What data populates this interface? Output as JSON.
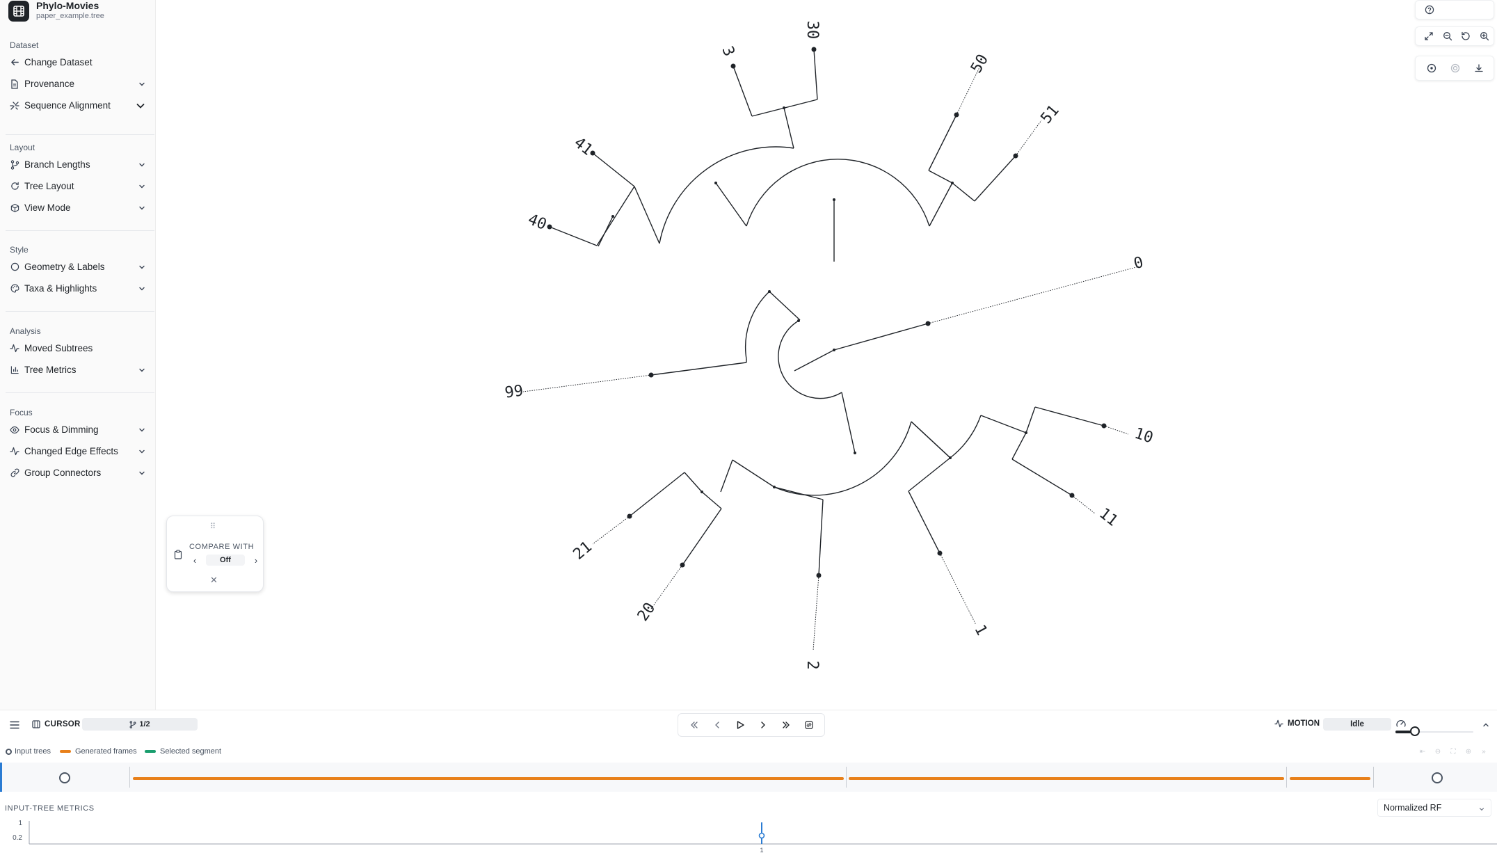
{
  "app": {
    "title": "Phylo-Movies",
    "file": "paper_example.tree"
  },
  "sidebar": {
    "sections": [
      {
        "title": "Dataset",
        "items": [
          {
            "label": "Change Dataset",
            "icon": "arrow-left-icon"
          },
          {
            "label": "Provenance",
            "icon": "document-icon"
          },
          {
            "label": "Sequence Alignment",
            "icon": "alignment-icon"
          }
        ]
      },
      {
        "title": "Layout",
        "items": [
          {
            "label": "Branch Lengths",
            "icon": "branch-icon"
          },
          {
            "label": "Tree Layout",
            "icon": "refresh-icon"
          },
          {
            "label": "View Mode",
            "icon": "cube-icon"
          }
        ]
      },
      {
        "title": "Style",
        "items": [
          {
            "label": "Geometry & Labels",
            "icon": "circle-icon"
          },
          {
            "label": "Taxa & Highlights",
            "icon": "palette-icon"
          }
        ]
      },
      {
        "title": "Analysis",
        "items": [
          {
            "label": "Moved Subtrees",
            "icon": "activity-icon"
          },
          {
            "label": "Tree Metrics",
            "icon": "bar-chart-icon"
          }
        ]
      },
      {
        "title": "Focus",
        "items": [
          {
            "label": "Focus & Dimming",
            "icon": "eye-icon"
          },
          {
            "label": "Changed Edge Effects",
            "icon": "activity-icon"
          },
          {
            "label": "Group Connectors",
            "icon": "link-icon"
          }
        ]
      }
    ]
  },
  "compare": {
    "title": "COMPARE WITH",
    "value": "Off"
  },
  "tree": {
    "leaves": [
      {
        "label": "0"
      },
      {
        "label": "10"
      },
      {
        "label": "11"
      },
      {
        "label": "1"
      },
      {
        "label": "2"
      },
      {
        "label": "20"
      },
      {
        "label": "21"
      },
      {
        "label": "99"
      },
      {
        "label": "40"
      },
      {
        "label": "41"
      },
      {
        "label": "3"
      },
      {
        "label": "30"
      },
      {
        "label": "50"
      },
      {
        "label": "51"
      }
    ]
  },
  "toolbar": {
    "icons": [
      "help-icon",
      "fullscreen-icon",
      "zoom-out-icon",
      "reset-icon",
      "zoom-in-icon",
      "center-icon",
      "target-icon",
      "download-icon"
    ]
  },
  "bottom": {
    "cursor_label": "CURSOR",
    "cursor_value": "1/2",
    "motion_label": "MOTION",
    "motion_value": "Idle",
    "speed_fraction": 0.25
  },
  "legend": {
    "input_trees": "Input trees",
    "generated_frames": "Generated frames",
    "selected_segment": "Selected segment",
    "colors": {
      "generated": "#e8801a",
      "selected": "#1a9e6e",
      "cursor": "#2b7cd3"
    }
  },
  "metrics": {
    "title": "INPUT-TREE METRICS",
    "metric": "Normalized RF",
    "y_ticks": [
      "1",
      "0.2"
    ],
    "x_tick": "1"
  }
}
